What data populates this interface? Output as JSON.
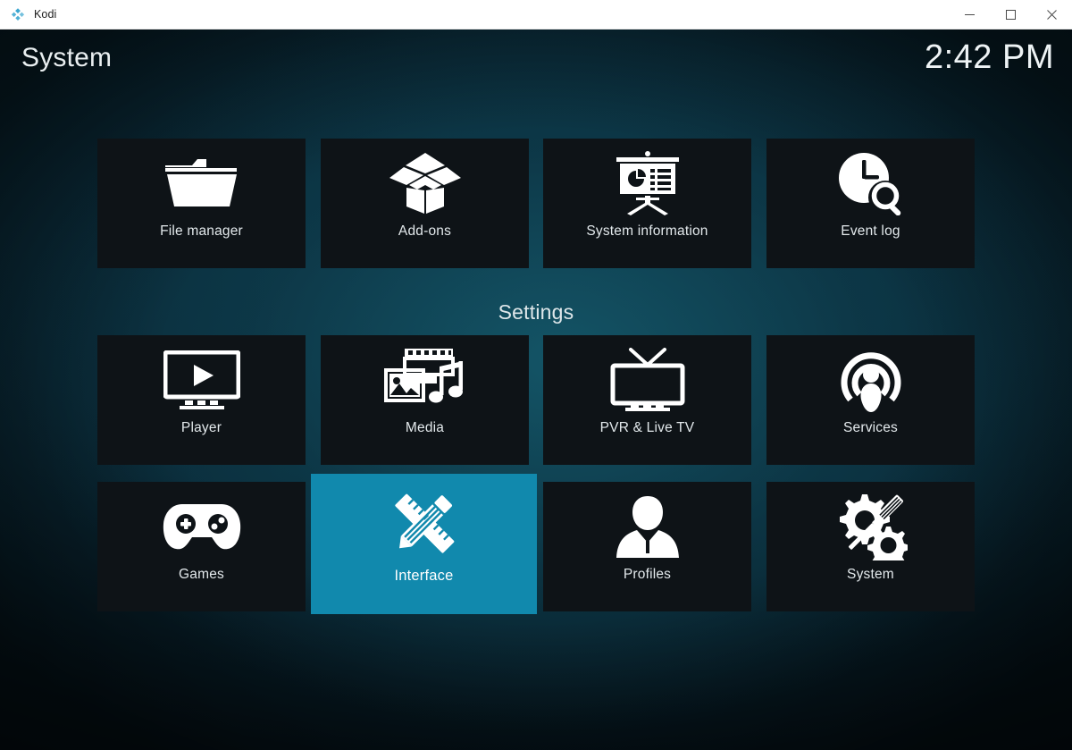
{
  "window": {
    "app_title": "Kodi",
    "logo_icon": "kodi-logo-icon",
    "controls": {
      "minimize": "minimize-icon",
      "maximize": "maximize-icon",
      "close": "close-icon"
    }
  },
  "header": {
    "page_title": "System",
    "clock": "2:42 PM"
  },
  "sections": {
    "settings_heading": "Settings"
  },
  "colors": {
    "focus_highlight": "#1189ad",
    "tile_background": "#0e1317",
    "text": "#e3e9ec",
    "background_top": "#0a2c3a",
    "background_bottom": "#010406"
  },
  "tiles": {
    "top_row": [
      {
        "label": "File manager",
        "icon": "folder-icon",
        "selected": false
      },
      {
        "label": "Add-ons",
        "icon": "open-box-icon",
        "selected": false
      },
      {
        "label": "System information",
        "icon": "presentation-board-icon",
        "selected": false
      },
      {
        "label": "Event log",
        "icon": "clock-search-icon",
        "selected": false
      }
    ],
    "settings_row_1": [
      {
        "label": "Player",
        "icon": "monitor-play-icon",
        "selected": false
      },
      {
        "label": "Media",
        "icon": "film-photo-music-icon",
        "selected": false
      },
      {
        "label": "PVR & Live TV",
        "icon": "tv-antenna-icon",
        "selected": false
      },
      {
        "label": "Services",
        "icon": "broadcast-person-icon",
        "selected": false
      }
    ],
    "settings_row_2": [
      {
        "label": "Games",
        "icon": "gamepad-icon",
        "selected": false
      },
      {
        "label": "Interface",
        "icon": "ruler-pencil-icon",
        "selected": true
      },
      {
        "label": "Profiles",
        "icon": "person-silhouette-icon",
        "selected": false
      },
      {
        "label": "System",
        "icon": "gears-screwdriver-icon",
        "selected": false
      }
    ]
  }
}
